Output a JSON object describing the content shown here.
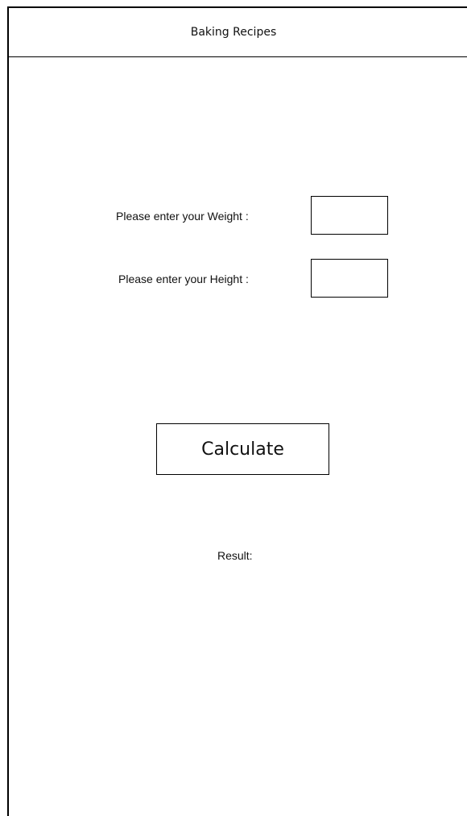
{
  "header": {
    "title": "Baking Recipes"
  },
  "form": {
    "weight_label": "Please enter your Weight :",
    "weight_value": "",
    "height_label": "Please enter your Height :",
    "height_value": ""
  },
  "actions": {
    "calculate_label": "Calculate"
  },
  "result": {
    "label": "Result:"
  }
}
